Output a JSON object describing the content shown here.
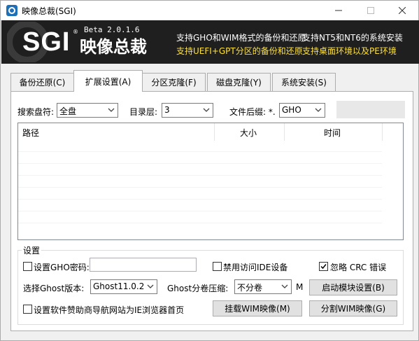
{
  "window": {
    "title": "映像总裁(SGI)"
  },
  "banner": {
    "logo": "SGI",
    "logo_cn": "映像总裁",
    "version": "Beta 2.0.1.6",
    "features": [
      {
        "text": "支持GHO和WIM格式的备份和还原",
        "color": "#ffffff"
      },
      {
        "text": "支持NT5和NT6的系统安装",
        "color": "#ffffff"
      },
      {
        "text": "支持UEFI+GPT分区的备份和还原",
        "color": "#ffe135"
      },
      {
        "text": "支持桌面环境以及PE环境",
        "color": "#ffe135"
      }
    ]
  },
  "tabs": [
    "备份还原(C)",
    "扩展设置(A)",
    "分区克隆(F)",
    "磁盘克隆(Y)",
    "系统安装(S)"
  ],
  "search": {
    "drive_label": "搜索盘符:",
    "drive_value": "全盘",
    "depth_label": "目录层:",
    "depth_value": "3",
    "ext_label": "文件后缀: *.",
    "ext_value": "GHO"
  },
  "list": {
    "columns": [
      "路径",
      "大小",
      "时间"
    ]
  },
  "settings": {
    "title": "设置",
    "gho_password": "设置GHO密码:",
    "disable_ide": "禁用访问IDE设备",
    "ignore_crc": "忽略 CRC 错误",
    "ghost_version_label": "选择Ghost版本:",
    "ghost_version_value": "Ghost11.0.2",
    "compress_label": "Ghost分卷压缩:",
    "compress_value": "不分卷",
    "compress_unit": "M",
    "homepage": "设置软件赞助商导航网站为IE浏览器首页",
    "boot_module_button": "启动模块设置(B)",
    "mount_wim_button": "挂载WIM映像(M)",
    "split_wim_button": "分割WIM映像(G)",
    "ignore_crc_checked": true
  }
}
